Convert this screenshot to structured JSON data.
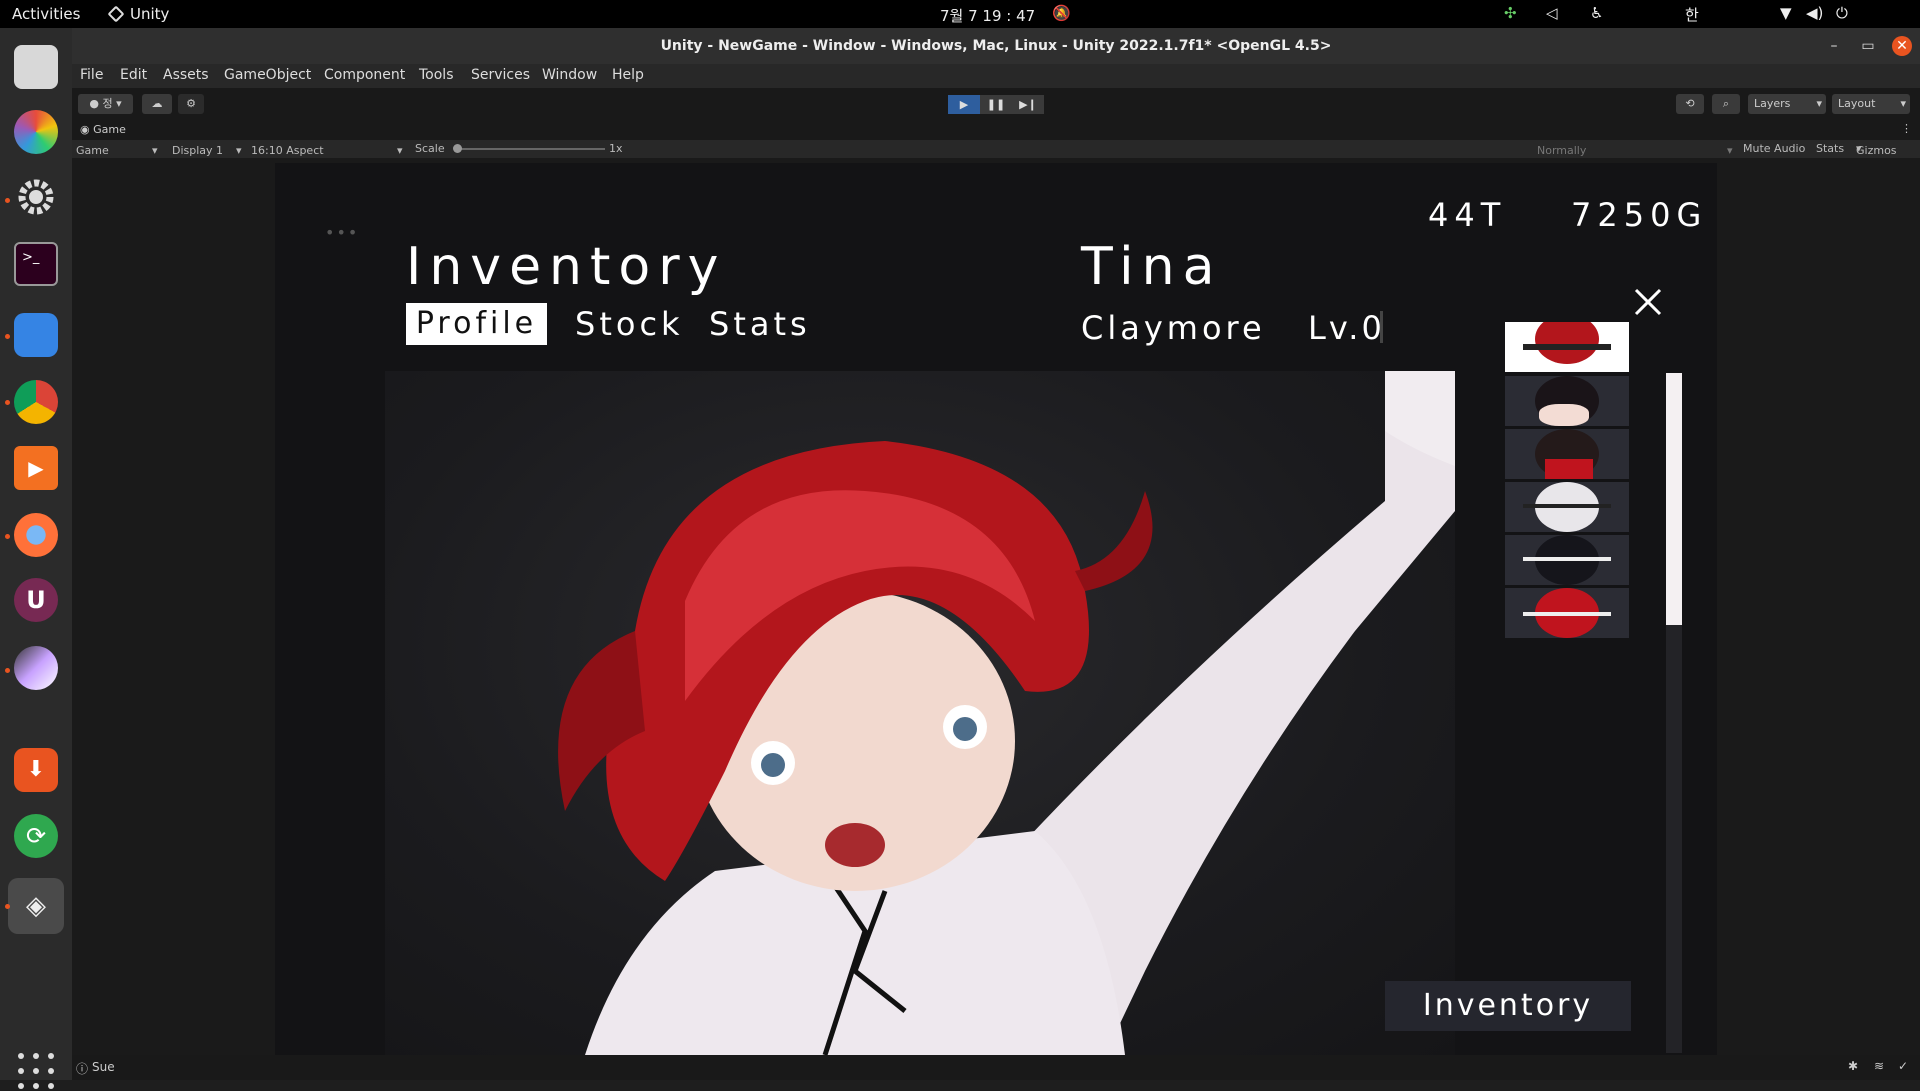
{
  "system_bar": {
    "activities": "Activities",
    "app_name": "Unity",
    "clock": "7월 7  19 : 47",
    "ime": "한"
  },
  "window": {
    "title": "Unity - NewGame - Window - Windows, Mac, Linux - Unity 2022.1.7f1* <OpenGL 4.5>"
  },
  "menu": [
    "File",
    "Edit",
    "Assets",
    "GameObject",
    "Component",
    "Tools",
    "Services",
    "Window",
    "Help"
  ],
  "toolbar": {
    "account": "정",
    "layers": "Layers",
    "layout": "Layout"
  },
  "game_tab": {
    "label": "Game",
    "view": "Game",
    "display": "Display 1",
    "aspect": "16:10 Aspect",
    "scale_label": "Scale",
    "scale_value": "1x",
    "normally": "Normally",
    "mute_audio": "Mute Audio",
    "stats": "Stats",
    "gizmos": "Gizmos"
  },
  "game": {
    "turns": "44T",
    "gold": "7250G",
    "screen_title": "Inventory",
    "tabs": [
      "Profile",
      "Stock",
      "Stats"
    ],
    "character_name": "Tina",
    "weapon": "Claymore",
    "level": "Lv.0",
    "inventory_button": "Inventory",
    "hair_colors": [
      "#b3161c",
      "#1a1418",
      "#241a1a",
      "#e8e6ea",
      "#15151b",
      "#c0141e"
    ],
    "scroll_fraction": 0.37
  },
  "status": {
    "message": "Sue"
  },
  "colors": {
    "accent": "#e95420",
    "play_active": "#2e5e9e"
  }
}
